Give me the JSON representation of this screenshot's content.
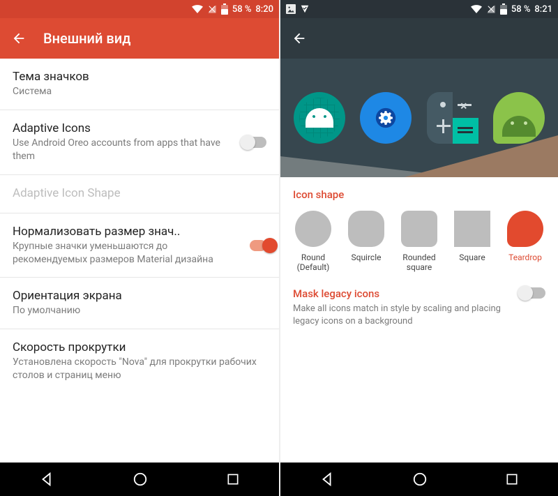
{
  "left": {
    "status": {
      "battery": "58 %",
      "time": "8:20"
    },
    "appbar": {
      "title": "Внешний вид"
    },
    "rows": {
      "theme": {
        "title": "Тема значков",
        "sub": "Система"
      },
      "adaptive": {
        "title": "Adaptive Icons",
        "sub": "Use Android Oreo accounts from apps that have them"
      },
      "adaptive_shape": {
        "title": "Adaptive Icon Shape"
      },
      "normalize": {
        "title": "Нормализовать размер знач..",
        "sub": "Крупные значки уменьшаются до рекомендуемых размеров Material дизайна"
      },
      "orientation": {
        "title": "Ориентация экрана",
        "sub": "По умолчанию"
      },
      "scroll": {
        "title": "Скорость прокрутки",
        "sub": "Установлена скорость \"Nova\" для прокрутки рабочих столов и страниц меню"
      }
    }
  },
  "right": {
    "status": {
      "battery": "58 %",
      "time": "8:21"
    },
    "section_title": "Icon shape",
    "shapes": {
      "round": "Round\n(Default)",
      "squircle": "Squircle",
      "roundsq": "Rounded\nsquare",
      "square": "Square",
      "teardrop": "Teardrop"
    },
    "mask": {
      "title": "Mask legacy icons",
      "sub": "Make all icons match in style by scaling and placing legacy icons on a background"
    }
  }
}
